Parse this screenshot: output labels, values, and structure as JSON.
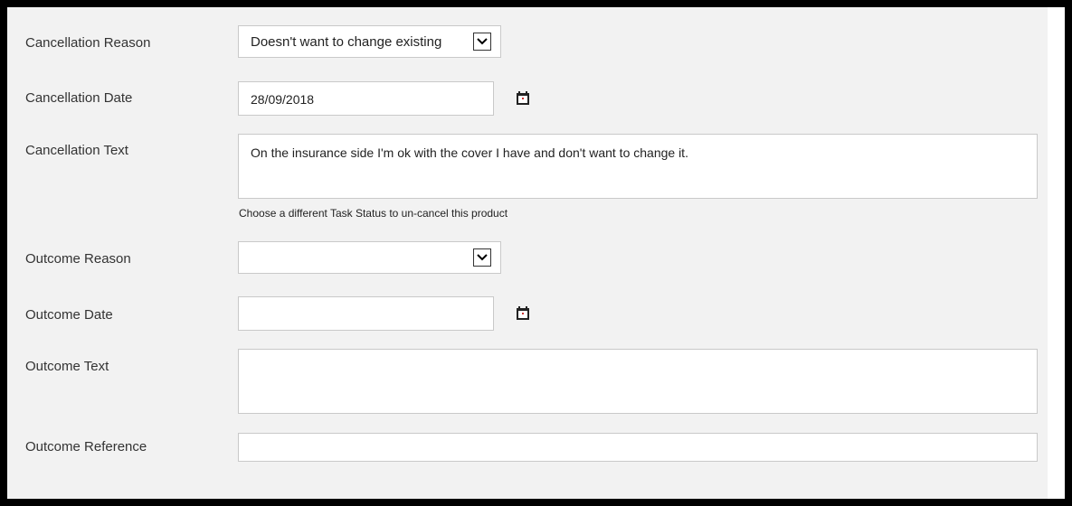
{
  "form": {
    "cancellation_reason": {
      "label": "Cancellation Reason",
      "selected": "Doesn't want to change existing"
    },
    "cancellation_date": {
      "label": "Cancellation Date",
      "value": "28/09/2018",
      "icon": "calendar-icon"
    },
    "cancellation_text": {
      "label": "Cancellation Text",
      "value": "On the insurance side I'm ok with the cover I have and don't want to change it."
    },
    "hint": "Choose a different Task Status to un-cancel this product",
    "outcome_reason": {
      "label": "Outcome Reason",
      "selected": ""
    },
    "outcome_date": {
      "label": "Outcome Date",
      "value": "",
      "icon": "calendar-icon"
    },
    "outcome_text": {
      "label": "Outcome Text",
      "value": ""
    },
    "outcome_reference": {
      "label": "Outcome Reference",
      "value": ""
    }
  },
  "colors": {
    "panel_bg": "#f2f2f2",
    "frame": "#000000",
    "field_border": "#c9c9c9"
  }
}
